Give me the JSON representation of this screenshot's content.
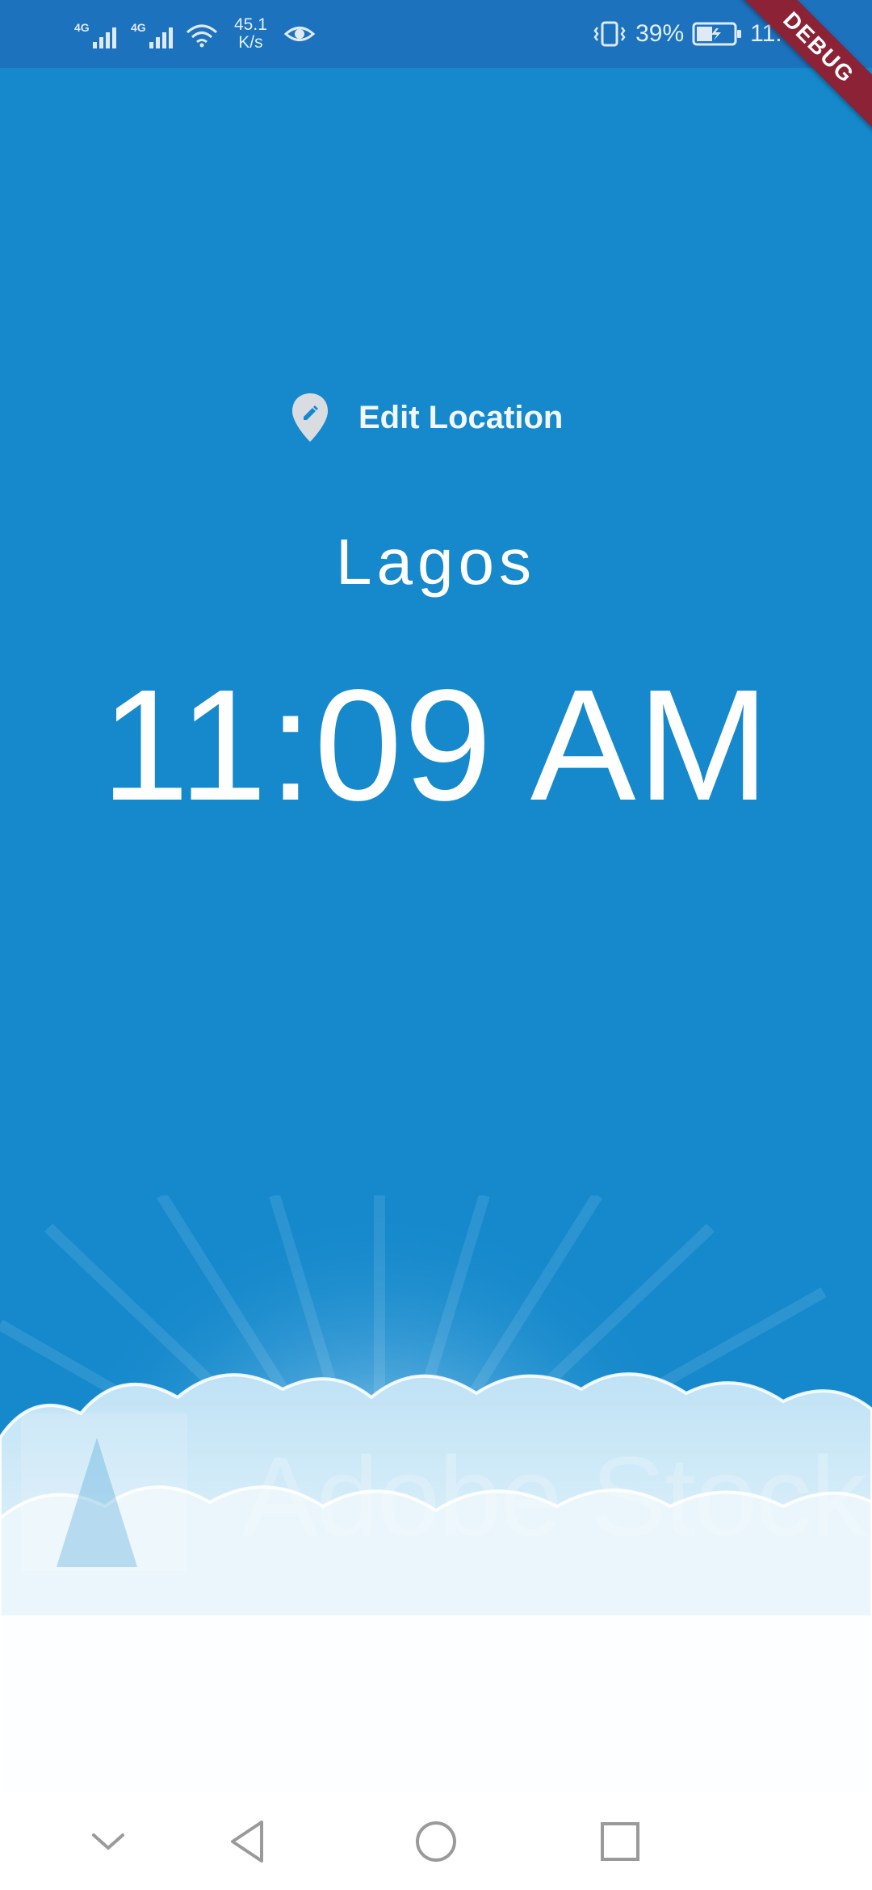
{
  "status_bar": {
    "net1": "4G",
    "net2": "4G",
    "speed_value": "45.1",
    "speed_unit": "K/s",
    "battery_pct": "39%",
    "clock": "11:09"
  },
  "debug_banner": "DEBUG",
  "main": {
    "edit_location_label": "Edit Location",
    "city": "Lagos",
    "time": "11:09 AM"
  },
  "watermark": "Adobe Stock",
  "icons": {
    "location": "location-pin-edit-icon",
    "eye": "eye-icon",
    "wifi": "wifi-icon",
    "vibrate": "vibrate-icon",
    "battery": "battery-charging-icon",
    "nav_down": "chevron-down-icon",
    "nav_back": "back-triangle-icon",
    "nav_home": "home-circle-icon",
    "nav_recents": "recents-square-icon"
  },
  "colors": {
    "background": "#1589cc",
    "status_bar": "#1c72bd",
    "debug_ribbon": "#8b2236",
    "text": "#ffffff"
  }
}
